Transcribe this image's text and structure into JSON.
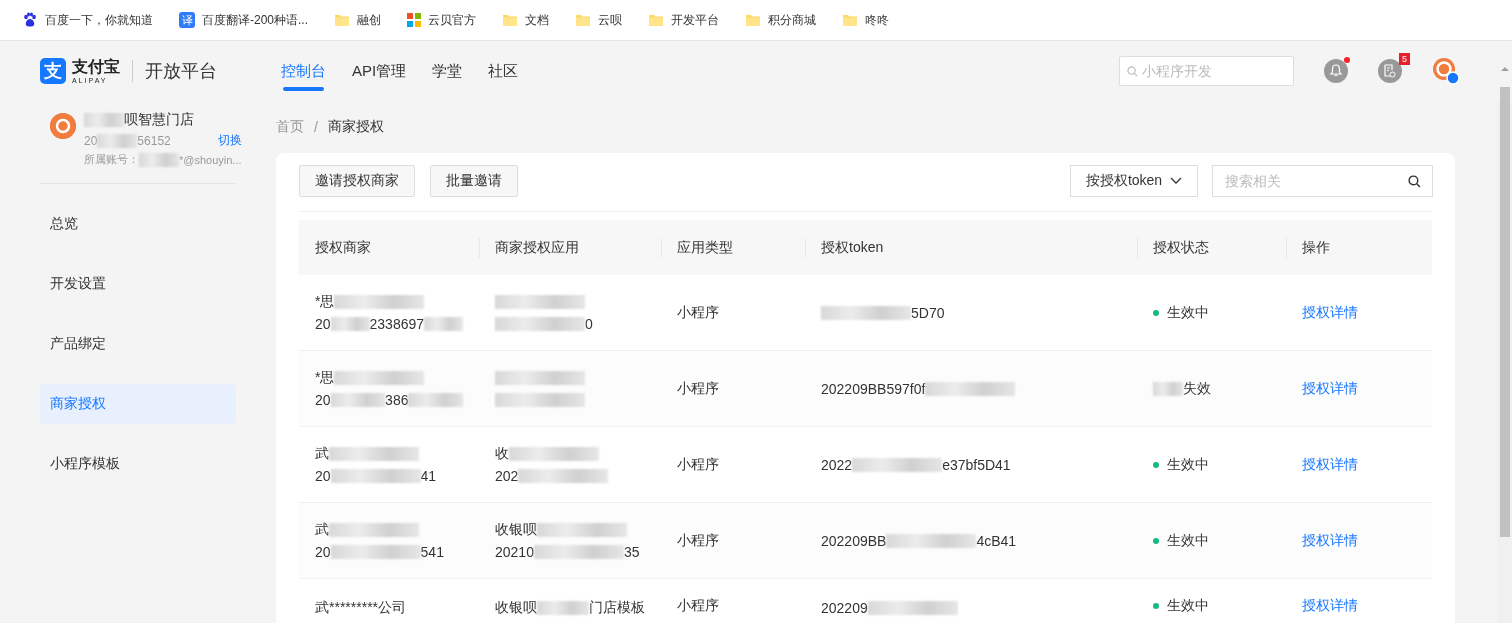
{
  "bookmarks": [
    {
      "kind": "baidu",
      "label": "百度一下，你就知道"
    },
    {
      "kind": "translate",
      "glyph": "译",
      "label": "百度翻译-200种语..."
    },
    {
      "kind": "folder",
      "label": "融创"
    },
    {
      "kind": "tiles",
      "label": "云贝官方"
    },
    {
      "kind": "folder",
      "label": "文档"
    },
    {
      "kind": "folder",
      "label": "云呗"
    },
    {
      "kind": "folder",
      "label": "开发平台"
    },
    {
      "kind": "folder",
      "label": "积分商城"
    },
    {
      "kind": "folder",
      "label": "咚咚"
    }
  ],
  "header": {
    "logo": {
      "glyph": "支",
      "brand": "支付宝",
      "brand_en": "ALIPAY",
      "product": "开放平台"
    },
    "nav": [
      {
        "label": "控制台",
        "selected": true
      },
      {
        "label": "API管理",
        "selected": false
      },
      {
        "label": "学堂",
        "selected": false
      },
      {
        "label": "社区",
        "selected": false
      }
    ],
    "search": {
      "placeholder": "小程序开发"
    },
    "notifications": {
      "unread": true
    },
    "tasks": {
      "badge": "5"
    }
  },
  "sidebar": {
    "account": {
      "name": [
        {
          "kind": "blur"
        },
        {
          "kind": "text",
          "text": "呗智慧门店"
        }
      ],
      "id": [
        {
          "kind": "text",
          "text": "20"
        },
        {
          "kind": "blur"
        },
        {
          "kind": "text",
          "text": "56152"
        }
      ],
      "switch": "切换",
      "owner": [
        {
          "kind": "text",
          "text": "所属账号："
        },
        {
          "kind": "blur"
        },
        {
          "kind": "text",
          "text": "*@shouyin..."
        }
      ]
    },
    "items": [
      {
        "label": "总览",
        "selected": false
      },
      {
        "label": "开发设置",
        "selected": false
      },
      {
        "label": "产品绑定",
        "selected": false
      },
      {
        "label": "商家授权",
        "selected": true
      },
      {
        "label": "小程序模板",
        "selected": false
      }
    ]
  },
  "breadcrumb": {
    "items": [
      "首页",
      "商家授权"
    ],
    "separator": "/"
  },
  "toolbar": {
    "buttons": [
      "邀请授权商家",
      "批量邀请"
    ],
    "filter": "按授权token",
    "search": {
      "placeholder": "搜索相关"
    }
  },
  "table": {
    "columns": [
      "授权商家",
      "商家授权应用",
      "应用类型",
      "授权token",
      "授权状态",
      "操作"
    ],
    "rows": [
      {
        "merchant": [
          [
            {
              "kind": "text",
              "text": "*思"
            },
            {
              "kind": "blur"
            }
          ],
          [
            {
              "kind": "text",
              "text": "20"
            },
            {
              "kind": "blur"
            },
            {
              "kind": "text",
              "text": "2338697"
            },
            {
              "kind": "blur"
            }
          ]
        ],
        "app": [
          [
            {
              "kind": "blur"
            }
          ],
          [
            {
              "kind": "blur"
            },
            {
              "kind": "text",
              "text": "0"
            }
          ]
        ],
        "type": "小程序",
        "token": [
          {
            "kind": "blur"
          },
          {
            "kind": "text",
            "text": "5D70"
          }
        ],
        "status": {
          "active": true,
          "text": "生效中"
        },
        "action": "授权详情"
      },
      {
        "merchant": [
          [
            {
              "kind": "text",
              "text": "*思"
            },
            {
              "kind": "blur"
            }
          ],
          [
            {
              "kind": "text",
              "text": "20"
            },
            {
              "kind": "blur"
            },
            {
              "kind": "text",
              "text": "386"
            },
            {
              "kind": "blur"
            }
          ]
        ],
        "app": [
          [
            {
              "kind": "blur"
            }
          ],
          [
            {
              "kind": "blur"
            }
          ]
        ],
        "type": "小程序",
        "token": [
          {
            "kind": "text",
            "text": "202209BB597f0f"
          },
          {
            "kind": "blur"
          }
        ],
        "status": {
          "active": false,
          "text": "失效"
        },
        "action": "授权详情"
      },
      {
        "merchant": [
          [
            {
              "kind": "text",
              "text": "武"
            },
            {
              "kind": "blur"
            }
          ],
          [
            {
              "kind": "text",
              "text": "20"
            },
            {
              "kind": "blur"
            },
            {
              "kind": "text",
              "text": "41"
            }
          ]
        ],
        "app": [
          [
            {
              "kind": "text",
              "text": "收"
            },
            {
              "kind": "blur"
            }
          ],
          [
            {
              "kind": "text",
              "text": "202"
            },
            {
              "kind": "blur"
            }
          ]
        ],
        "type": "小程序",
        "token": [
          {
            "kind": "text",
            "text": "2022"
          },
          {
            "kind": "blur"
          },
          {
            "kind": "text",
            "text": "e37bf5D41"
          }
        ],
        "status": {
          "active": true,
          "text": "生效中"
        },
        "action": "授权详情"
      },
      {
        "merchant": [
          [
            {
              "kind": "text",
              "text": "武"
            },
            {
              "kind": "blur"
            }
          ],
          [
            {
              "kind": "text",
              "text": "20"
            },
            {
              "kind": "blur"
            },
            {
              "kind": "text",
              "text": "541"
            }
          ]
        ],
        "app": [
          [
            {
              "kind": "text",
              "text": "收银呗"
            },
            {
              "kind": "blur"
            }
          ],
          [
            {
              "kind": "text",
              "text": "20210"
            },
            {
              "kind": "blur"
            },
            {
              "kind": "text",
              "text": "35"
            }
          ]
        ],
        "type": "小程序",
        "token": [
          {
            "kind": "text",
            "text": "202209BB"
          },
          {
            "kind": "blur"
          },
          {
            "kind": "text",
            "text": "4cB41"
          }
        ],
        "status": {
          "active": true,
          "text": "生效中"
        },
        "action": "授权详情"
      },
      {
        "merchant": [
          [
            {
              "kind": "text",
              "text": "武*********公司"
            }
          ]
        ],
        "app": [
          [
            {
              "kind": "text",
              "text": "收银呗"
            },
            {
              "kind": "blur"
            },
            {
              "kind": "text",
              "text": "门店模板"
            }
          ]
        ],
        "type": "小程序",
        "token": [
          {
            "kind": "text",
            "text": "202209"
          },
          {
            "kind": "blur"
          }
        ],
        "status": {
          "active": true,
          "text": "生效中"
        },
        "action": "授权详情"
      }
    ]
  }
}
